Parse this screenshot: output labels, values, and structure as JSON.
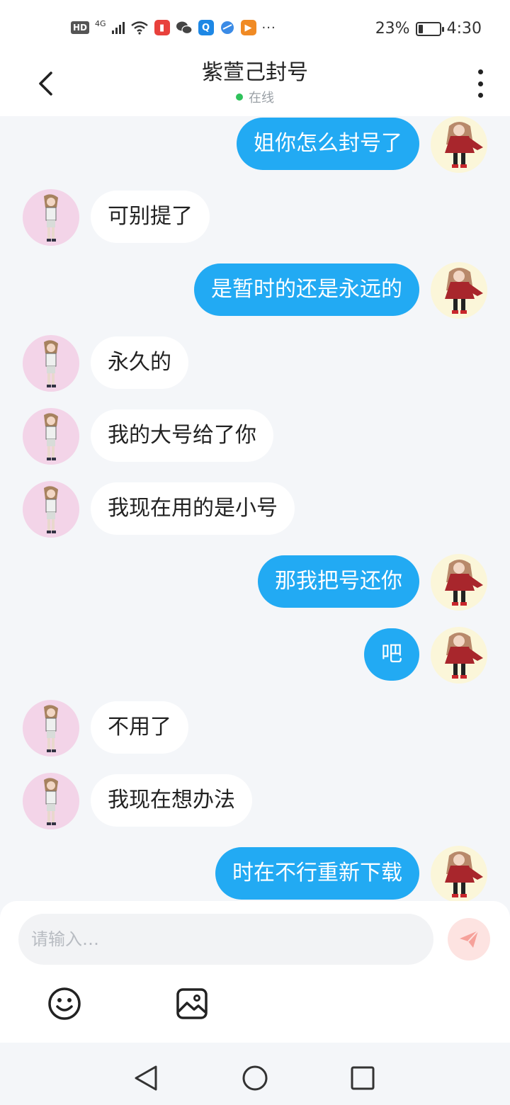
{
  "status_bar": {
    "hd_label": "HD",
    "network_label": "4G",
    "battery_percent": "23%",
    "battery_level": 0.23,
    "time": "4:30",
    "overflow": "···"
  },
  "header": {
    "title": "紫萱己封号",
    "status": "在线",
    "status_color": "#2fc25b"
  },
  "colors": {
    "outgoing_bubble": "#22aaf3",
    "incoming_bubble": "#ffffff",
    "background": "#f4f6f9"
  },
  "messages": [
    {
      "side": "mine",
      "text": "姐你怎么封号了"
    },
    {
      "side": "theirs",
      "text": "可别提了"
    },
    {
      "side": "mine",
      "text": "是暂时的还是永远的"
    },
    {
      "side": "theirs",
      "text": "永久的"
    },
    {
      "side": "theirs",
      "text": "我的大号给了你"
    },
    {
      "side": "theirs",
      "text": "我现在用的是小号"
    },
    {
      "side": "mine",
      "text": "那我把号还你"
    },
    {
      "side": "mine",
      "text": "吧"
    },
    {
      "side": "theirs",
      "text": "不用了"
    },
    {
      "side": "theirs",
      "text": "我现在想办法"
    },
    {
      "side": "mine",
      "text": "时在不行重新下载"
    }
  ],
  "composer": {
    "placeholder": "请输入…",
    "value": ""
  },
  "icons": {
    "back": "chevron-left-icon",
    "more": "more-vertical-icon",
    "send": "paper-plane-icon",
    "emoji": "smiley-icon",
    "image": "image-icon",
    "nav_back": "triangle-back-icon",
    "nav_home": "circle-home-icon",
    "nav_recent": "square-recent-icon"
  }
}
